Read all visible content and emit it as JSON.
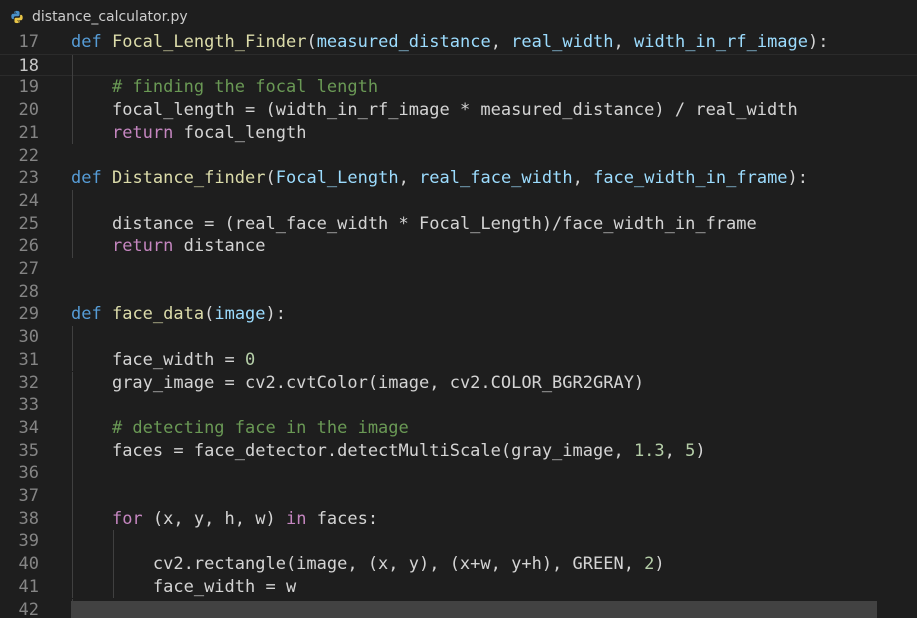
{
  "tab": {
    "filename": "distance_calculator.py",
    "icon": "python-icon"
  },
  "editor": {
    "current_line": 18,
    "lines": [
      {
        "n": "17",
        "indent": 0,
        "tokens": [
          [
            "kw",
            "def"
          ],
          [
            "plain",
            " "
          ],
          [
            "fn",
            "Focal_Length_Finder"
          ],
          [
            "plain",
            "("
          ],
          [
            "param",
            "measured_distance"
          ],
          [
            "plain",
            ", "
          ],
          [
            "param",
            "real_width"
          ],
          [
            "plain",
            ", "
          ],
          [
            "param",
            "width_in_rf_image"
          ],
          [
            "plain",
            "):"
          ]
        ]
      },
      {
        "n": "18",
        "indent": 1,
        "tokens": []
      },
      {
        "n": "19",
        "indent": 1,
        "tokens": [
          [
            "cm",
            "# finding the focal length"
          ]
        ]
      },
      {
        "n": "20",
        "indent": 1,
        "tokens": [
          [
            "plain",
            "focal_length = (width_in_rf_image * measured_distance) / real_width"
          ]
        ]
      },
      {
        "n": "21",
        "indent": 1,
        "tokens": [
          [
            "ctl",
            "return"
          ],
          [
            "plain",
            " focal_length"
          ]
        ]
      },
      {
        "n": "22",
        "indent": 0,
        "tokens": []
      },
      {
        "n": "23",
        "indent": 0,
        "tokens": [
          [
            "kw",
            "def"
          ],
          [
            "plain",
            " "
          ],
          [
            "fn",
            "Distance_finder"
          ],
          [
            "plain",
            "("
          ],
          [
            "param",
            "Focal_Length"
          ],
          [
            "plain",
            ", "
          ],
          [
            "param",
            "real_face_width"
          ],
          [
            "plain",
            ", "
          ],
          [
            "param",
            "face_width_in_frame"
          ],
          [
            "plain",
            "):"
          ]
        ]
      },
      {
        "n": "24",
        "indent": 1,
        "tokens": []
      },
      {
        "n": "25",
        "indent": 1,
        "tokens": [
          [
            "plain",
            "distance = (real_face_width * Focal_Length)/face_width_in_frame"
          ]
        ]
      },
      {
        "n": "26",
        "indent": 1,
        "tokens": [
          [
            "ctl",
            "return"
          ],
          [
            "plain",
            " distance"
          ]
        ]
      },
      {
        "n": "27",
        "indent": 0,
        "tokens": []
      },
      {
        "n": "28",
        "indent": 0,
        "tokens": []
      },
      {
        "n": "29",
        "indent": 0,
        "tokens": [
          [
            "kw",
            "def"
          ],
          [
            "plain",
            " "
          ],
          [
            "fn",
            "face_data"
          ],
          [
            "plain",
            "("
          ],
          [
            "param",
            "image"
          ],
          [
            "plain",
            "):"
          ]
        ]
      },
      {
        "n": "30",
        "indent": 1,
        "tokens": []
      },
      {
        "n": "31",
        "indent": 1,
        "tokens": [
          [
            "plain",
            "face_width = "
          ],
          [
            "num",
            "0"
          ]
        ]
      },
      {
        "n": "32",
        "indent": 1,
        "tokens": [
          [
            "plain",
            "gray_image = cv2.cvtColor(image, cv2.COLOR_BGR2GRAY)"
          ]
        ]
      },
      {
        "n": "33",
        "indent": 1,
        "tokens": []
      },
      {
        "n": "34",
        "indent": 1,
        "tokens": [
          [
            "cm",
            "# detecting face in the image"
          ]
        ]
      },
      {
        "n": "35",
        "indent": 1,
        "tokens": [
          [
            "plain",
            "faces = face_detector.detectMultiScale(gray_image, "
          ],
          [
            "num",
            "1.3"
          ],
          [
            "plain",
            ", "
          ],
          [
            "num",
            "5"
          ],
          [
            "plain",
            ")"
          ]
        ]
      },
      {
        "n": "36",
        "indent": 1,
        "tokens": []
      },
      {
        "n": "37",
        "indent": 1,
        "tokens": []
      },
      {
        "n": "38",
        "indent": 1,
        "tokens": [
          [
            "ctl",
            "for"
          ],
          [
            "plain",
            " (x, y, h, w) "
          ],
          [
            "ctl",
            "in"
          ],
          [
            "plain",
            " faces:"
          ]
        ]
      },
      {
        "n": "39",
        "indent": 2,
        "tokens": []
      },
      {
        "n": "40",
        "indent": 2,
        "tokens": [
          [
            "plain",
            "cv2.rectangle(image, (x, y), (x+w, y+h), GREEN, "
          ],
          [
            "num",
            "2"
          ],
          [
            "plain",
            ")"
          ]
        ]
      },
      {
        "n": "41",
        "indent": 2,
        "tokens": [
          [
            "plain",
            "face_width = w"
          ]
        ]
      },
      {
        "n": "42",
        "indent": 1,
        "tokens": []
      }
    ]
  },
  "colors": {
    "background": "#1e1e1e",
    "keyword": "#569cd6",
    "control": "#c586c0",
    "function": "#dcdcaa",
    "parameter": "#9cdcfe",
    "comment": "#6a9955",
    "number": "#b5cea8"
  }
}
